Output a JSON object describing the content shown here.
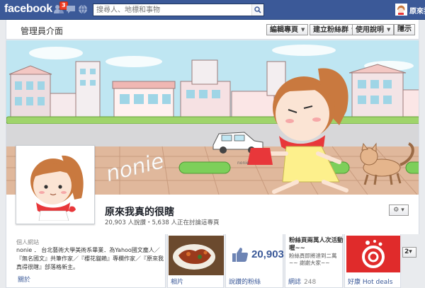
{
  "topbar": {
    "logo": "facebook",
    "notification_count": "3",
    "search_placeholder": "搜尋人、地標和事物",
    "user_name": "原來我"
  },
  "admin": {
    "title": "管理員介面",
    "buttons": [
      "編輯專頁",
      "建立粉絲群",
      "使用說明"
    ],
    "hide_label": "隱示"
  },
  "cover": {
    "signature": "nonie",
    "small_mark": "nonie"
  },
  "profile": {
    "name": "原來我真的很瞎",
    "stats": "20,903 人說讚・5,638 人正在討論這專頁",
    "gear_label": "⚙ ▾"
  },
  "about": {
    "heading": "個人網站",
    "text": "nonie ． 台北藝術大學美術系畢業．為Yahoo國文塵人／『無名國文』共筆作家／『櫻花貓賴』專欄作家／『原來我真得很瞎』部落格新主。",
    "link": "關於"
  },
  "tiles": {
    "photos_label": "相片",
    "likes_count": "20,903",
    "likes_label": "說讚的粉絲",
    "notes_title": "粉絲頁兩萬人次活動喔~~",
    "notes_body": "粉絲頁即將達到二萬~~ 謝謝大家~~",
    "notes_label": "網誌",
    "notes_count": "248",
    "deals_label": "好康 Hot deals",
    "more_label": "2▾"
  },
  "colors": {
    "brand": "#3b5998",
    "sky": "#bfe6f2",
    "ground": "#e0b89c",
    "dress": "#fdf08c",
    "scarf": "#e8373a",
    "deals_red": "#e02b2b"
  }
}
